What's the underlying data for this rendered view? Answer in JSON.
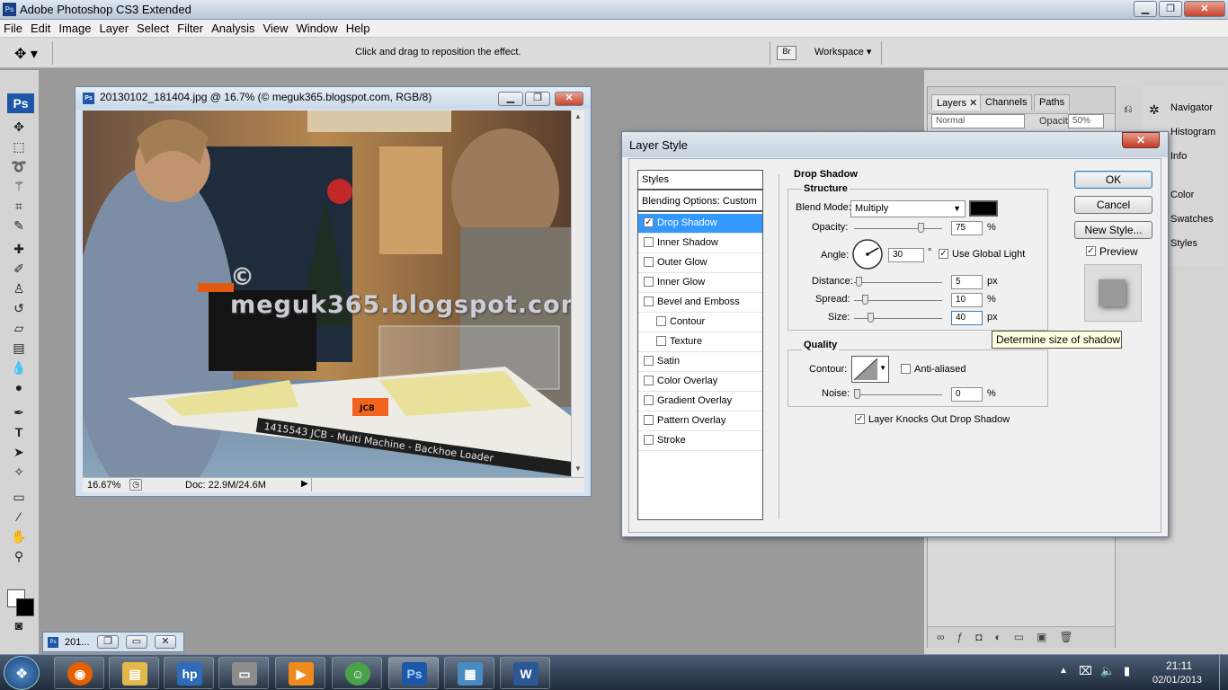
{
  "app": {
    "window_title": "Adobe Photoshop CS3 Extended",
    "app_icon": "Ps"
  },
  "menu": [
    "File",
    "Edit",
    "Image",
    "Layer",
    "Select",
    "Filter",
    "Analysis",
    "View",
    "Window",
    "Help"
  ],
  "options_bar": {
    "hint": "Click and drag to reposition the effect.",
    "workspace_label": "Workspace"
  },
  "tools": {
    "badge": "Ps"
  },
  "document": {
    "title": "20130102_181404.jpg @ 16.7% (© meguk365.blogspot.com, RGB/8)",
    "watermark": "© meguk365.blogspot.com",
    "zoom": "16.67%",
    "doc_size": "Doc: 22.9M/24.6M",
    "box_label": "1415543 JCB - Multi Machine - Backhoe Loader",
    "brand_label": "JCB"
  },
  "minimized_doc": {
    "label": "201..."
  },
  "layer_style": {
    "title": "Layer Style",
    "styles_header": "Styles",
    "blending_options": "Blending Options: Custom",
    "styles": [
      {
        "label": "Drop Shadow",
        "checked": true,
        "selected": true
      },
      {
        "label": "Inner Shadow",
        "checked": false
      },
      {
        "label": "Outer Glow",
        "checked": false
      },
      {
        "label": "Inner Glow",
        "checked": false
      },
      {
        "label": "Bevel and Emboss",
        "checked": false
      },
      {
        "label": "Contour",
        "checked": false,
        "indent": true
      },
      {
        "label": "Texture",
        "checked": false,
        "indent": true
      },
      {
        "label": "Satin",
        "checked": false
      },
      {
        "label": "Color Overlay",
        "checked": false
      },
      {
        "label": "Gradient Overlay",
        "checked": false
      },
      {
        "label": "Pattern Overlay",
        "checked": false
      },
      {
        "label": "Stroke",
        "checked": false
      }
    ],
    "section_title": "Drop Shadow",
    "structure": {
      "title": "Structure",
      "blend_mode_label": "Blend Mode:",
      "blend_mode_value": "Multiply",
      "shadow_color": "#000000",
      "opacity_label": "Opacity:",
      "opacity_value": "75",
      "opacity_level": 0.75,
      "percent": "%",
      "angle_label": "Angle:",
      "angle_value": "30",
      "degree": "°",
      "use_global_light": "Use Global Light",
      "distance_label": "Distance:",
      "distance_value": "5",
      "distance_level": 0.02,
      "spread_label": "Spread:",
      "spread_value": "10",
      "spread_level": 0.1,
      "size_label": "Size:",
      "size_value": "40",
      "size_level": 0.16,
      "px": "px"
    },
    "quality": {
      "title": "Quality",
      "contour_label": "Contour:",
      "anti_aliased": "Anti-aliased",
      "noise_label": "Noise:",
      "noise_value": "0",
      "noise_level": 0,
      "percent": "%"
    },
    "knocks_out": "Layer Knocks Out Drop Shadow",
    "buttons": {
      "ok": "OK",
      "cancel": "Cancel",
      "new_style": "New Style...",
      "preview": "Preview"
    },
    "tooltip": "Determine size of shadow"
  },
  "layers_panel": {
    "tabs": [
      "Layers",
      "Channels",
      "Paths"
    ],
    "blend_mode": "Normal",
    "opacity_label": "Opacity:",
    "opacity_value": "50%"
  },
  "side_panels": [
    "Navigator",
    "Histogram",
    "Info",
    "Color",
    "Swatches",
    "Styles"
  ],
  "taskbar": {
    "time": "21:11",
    "date": "02/01/2013"
  },
  "colors": {
    "selection": "#3399ff",
    "dialog_bg": "#f0f0f0",
    "ps_blue": "#1e56a8"
  }
}
